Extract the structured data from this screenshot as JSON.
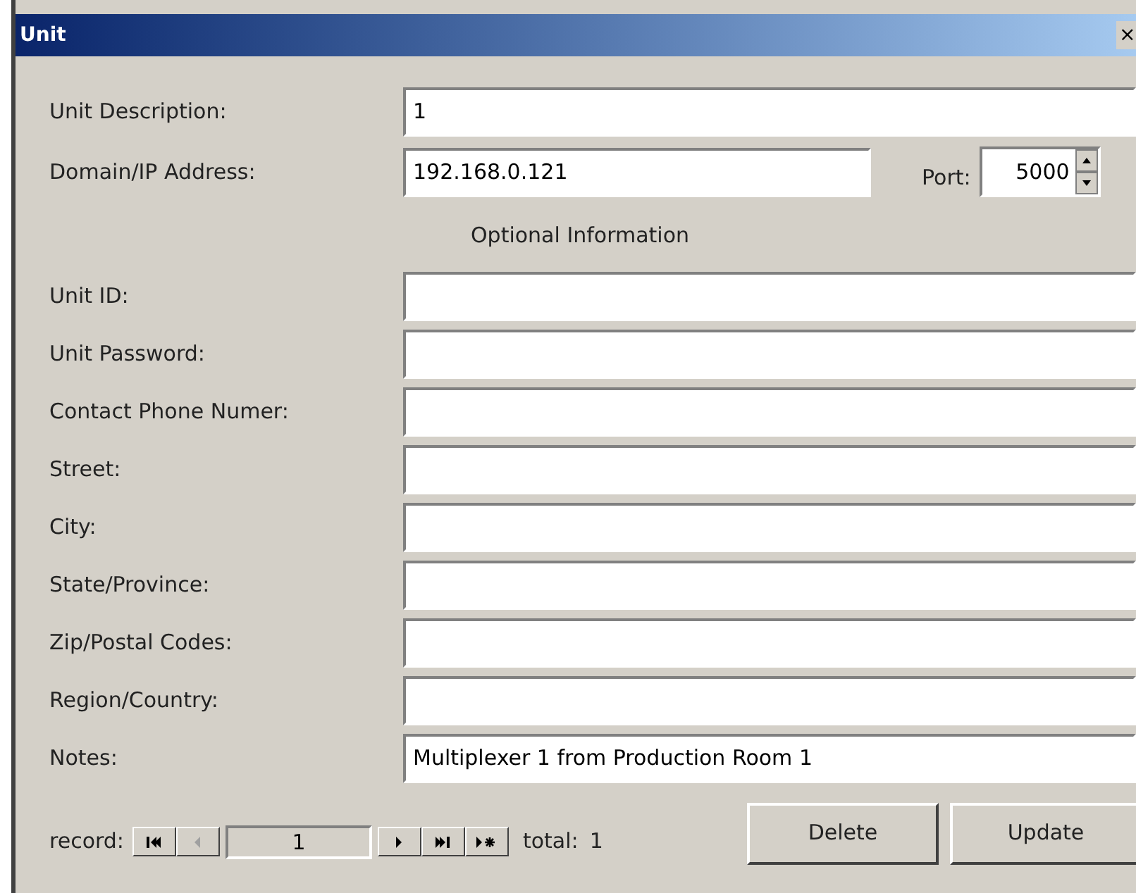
{
  "window": {
    "title": "Unit",
    "close": "×"
  },
  "unit_description": {
    "label": "Unit Description:",
    "value": "1"
  },
  "address": {
    "label": "Domain/IP Address:",
    "value": "192.168.0.121"
  },
  "port": {
    "label": "Port:",
    "value": "5000"
  },
  "section_title": "Optional Information",
  "optional_fields": [
    {
      "label": "Unit ID:"
    },
    {
      "label": "Unit Password:"
    },
    {
      "label": "Contact Phone Numer:"
    },
    {
      "label": "Street:"
    },
    {
      "label": "City:"
    },
    {
      "label": "State/Province:"
    },
    {
      "label": "Zip/Postal Codes:"
    },
    {
      "label": "Region/Country:"
    },
    {
      "label": "Notes:",
      "value": "Multiplexer 1 from Production Room 1"
    }
  ],
  "navigator": {
    "label": "record:",
    "current": "1",
    "total_label": "total:",
    "total": "1",
    "buttons": [
      {
        "kind": "first",
        "disabled": false
      },
      {
        "kind": "prev",
        "disabled": true
      },
      {
        "kind": "next",
        "disabled": false
      },
      {
        "kind": "last",
        "disabled": false
      },
      {
        "kind": "new",
        "disabled": false
      }
    ]
  },
  "buttons": [
    "Delete",
    "Update"
  ]
}
